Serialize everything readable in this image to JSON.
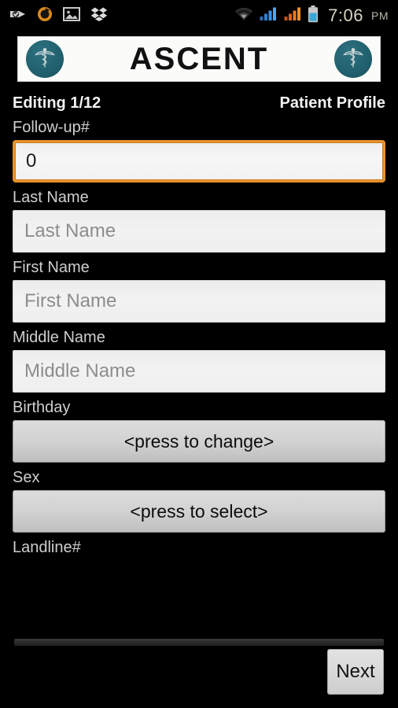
{
  "status_bar": {
    "left_icons": [
      {
        "name": "tag-check-icon",
        "label": "tag-check"
      },
      {
        "name": "sync-circle-icon",
        "label": "sync"
      },
      {
        "name": "gallery-image-icon",
        "label": "gallery"
      },
      {
        "name": "dropbox-icon",
        "label": "dropbox"
      }
    ],
    "right_icons": [
      {
        "name": "wifi-icon",
        "label": "wifi"
      },
      {
        "name": "signal-bars-sim1-icon",
        "label": "signal-1"
      },
      {
        "name": "signal-bars-sim2-icon",
        "label": "signal-2"
      },
      {
        "name": "battery-icon",
        "label": "battery"
      }
    ],
    "time": "7:06",
    "ampm": "PM"
  },
  "banner": {
    "title": "ASCENT",
    "left_logo": "caduceus-icon",
    "right_logo": "caduceus-icon"
  },
  "header": {
    "editing_status": "Editing 1/12",
    "section_title": "Patient Profile"
  },
  "form": {
    "fields": [
      {
        "key": "followup",
        "label": "Follow-up#",
        "type": "input",
        "value": "0",
        "placeholder": "",
        "focused": true
      },
      {
        "key": "last_name",
        "label": "Last Name",
        "type": "input",
        "value": "",
        "placeholder": "Last Name",
        "focused": false
      },
      {
        "key": "first_name",
        "label": "First Name",
        "type": "input",
        "value": "",
        "placeholder": "First Name",
        "focused": false
      },
      {
        "key": "middle_name",
        "label": "Middle Name",
        "type": "input",
        "value": "",
        "placeholder": "Middle Name",
        "focused": false
      },
      {
        "key": "birthday",
        "label": "Birthday",
        "type": "button",
        "value": "<press to change>"
      },
      {
        "key": "sex",
        "label": "Sex",
        "type": "button",
        "value": "<press to select>"
      },
      {
        "key": "landline",
        "label": "Landline#",
        "type": "cutoff"
      }
    ]
  },
  "footer": {
    "next_label": "Next"
  },
  "colors": {
    "background": "#000000",
    "accent_focus": "#e8922c",
    "logo_teal": "#21606e",
    "field_bg": "#f0f0f0",
    "button_bg": "#d2d2d2"
  }
}
